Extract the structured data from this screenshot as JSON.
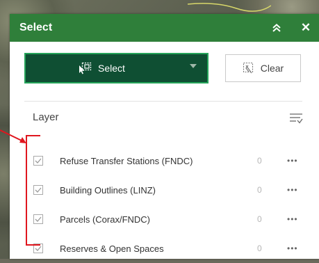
{
  "panel": {
    "title": "Select",
    "collapse_icon": "chevron-double-up-icon",
    "close_label": "✕"
  },
  "toolbar": {
    "select_label": "Select",
    "clear_label": "Clear"
  },
  "layers": {
    "heading": "Layer",
    "items": [
      {
        "label": "Refuse Transfer Stations (FNDC)",
        "count": "0",
        "checked": true
      },
      {
        "label": "Building Outlines (LINZ)",
        "count": "0",
        "checked": true
      },
      {
        "label": "Parcels (Corax/FNDC)",
        "count": "0",
        "checked": true
      },
      {
        "label": "Reserves & Open Spaces",
        "count": "0",
        "checked": true
      }
    ],
    "more_label": "•••"
  },
  "colors": {
    "header": "#2f7f3a",
    "select_button": "#0f4f33",
    "select_border": "#25a45a",
    "annotation": "#e0161e"
  }
}
